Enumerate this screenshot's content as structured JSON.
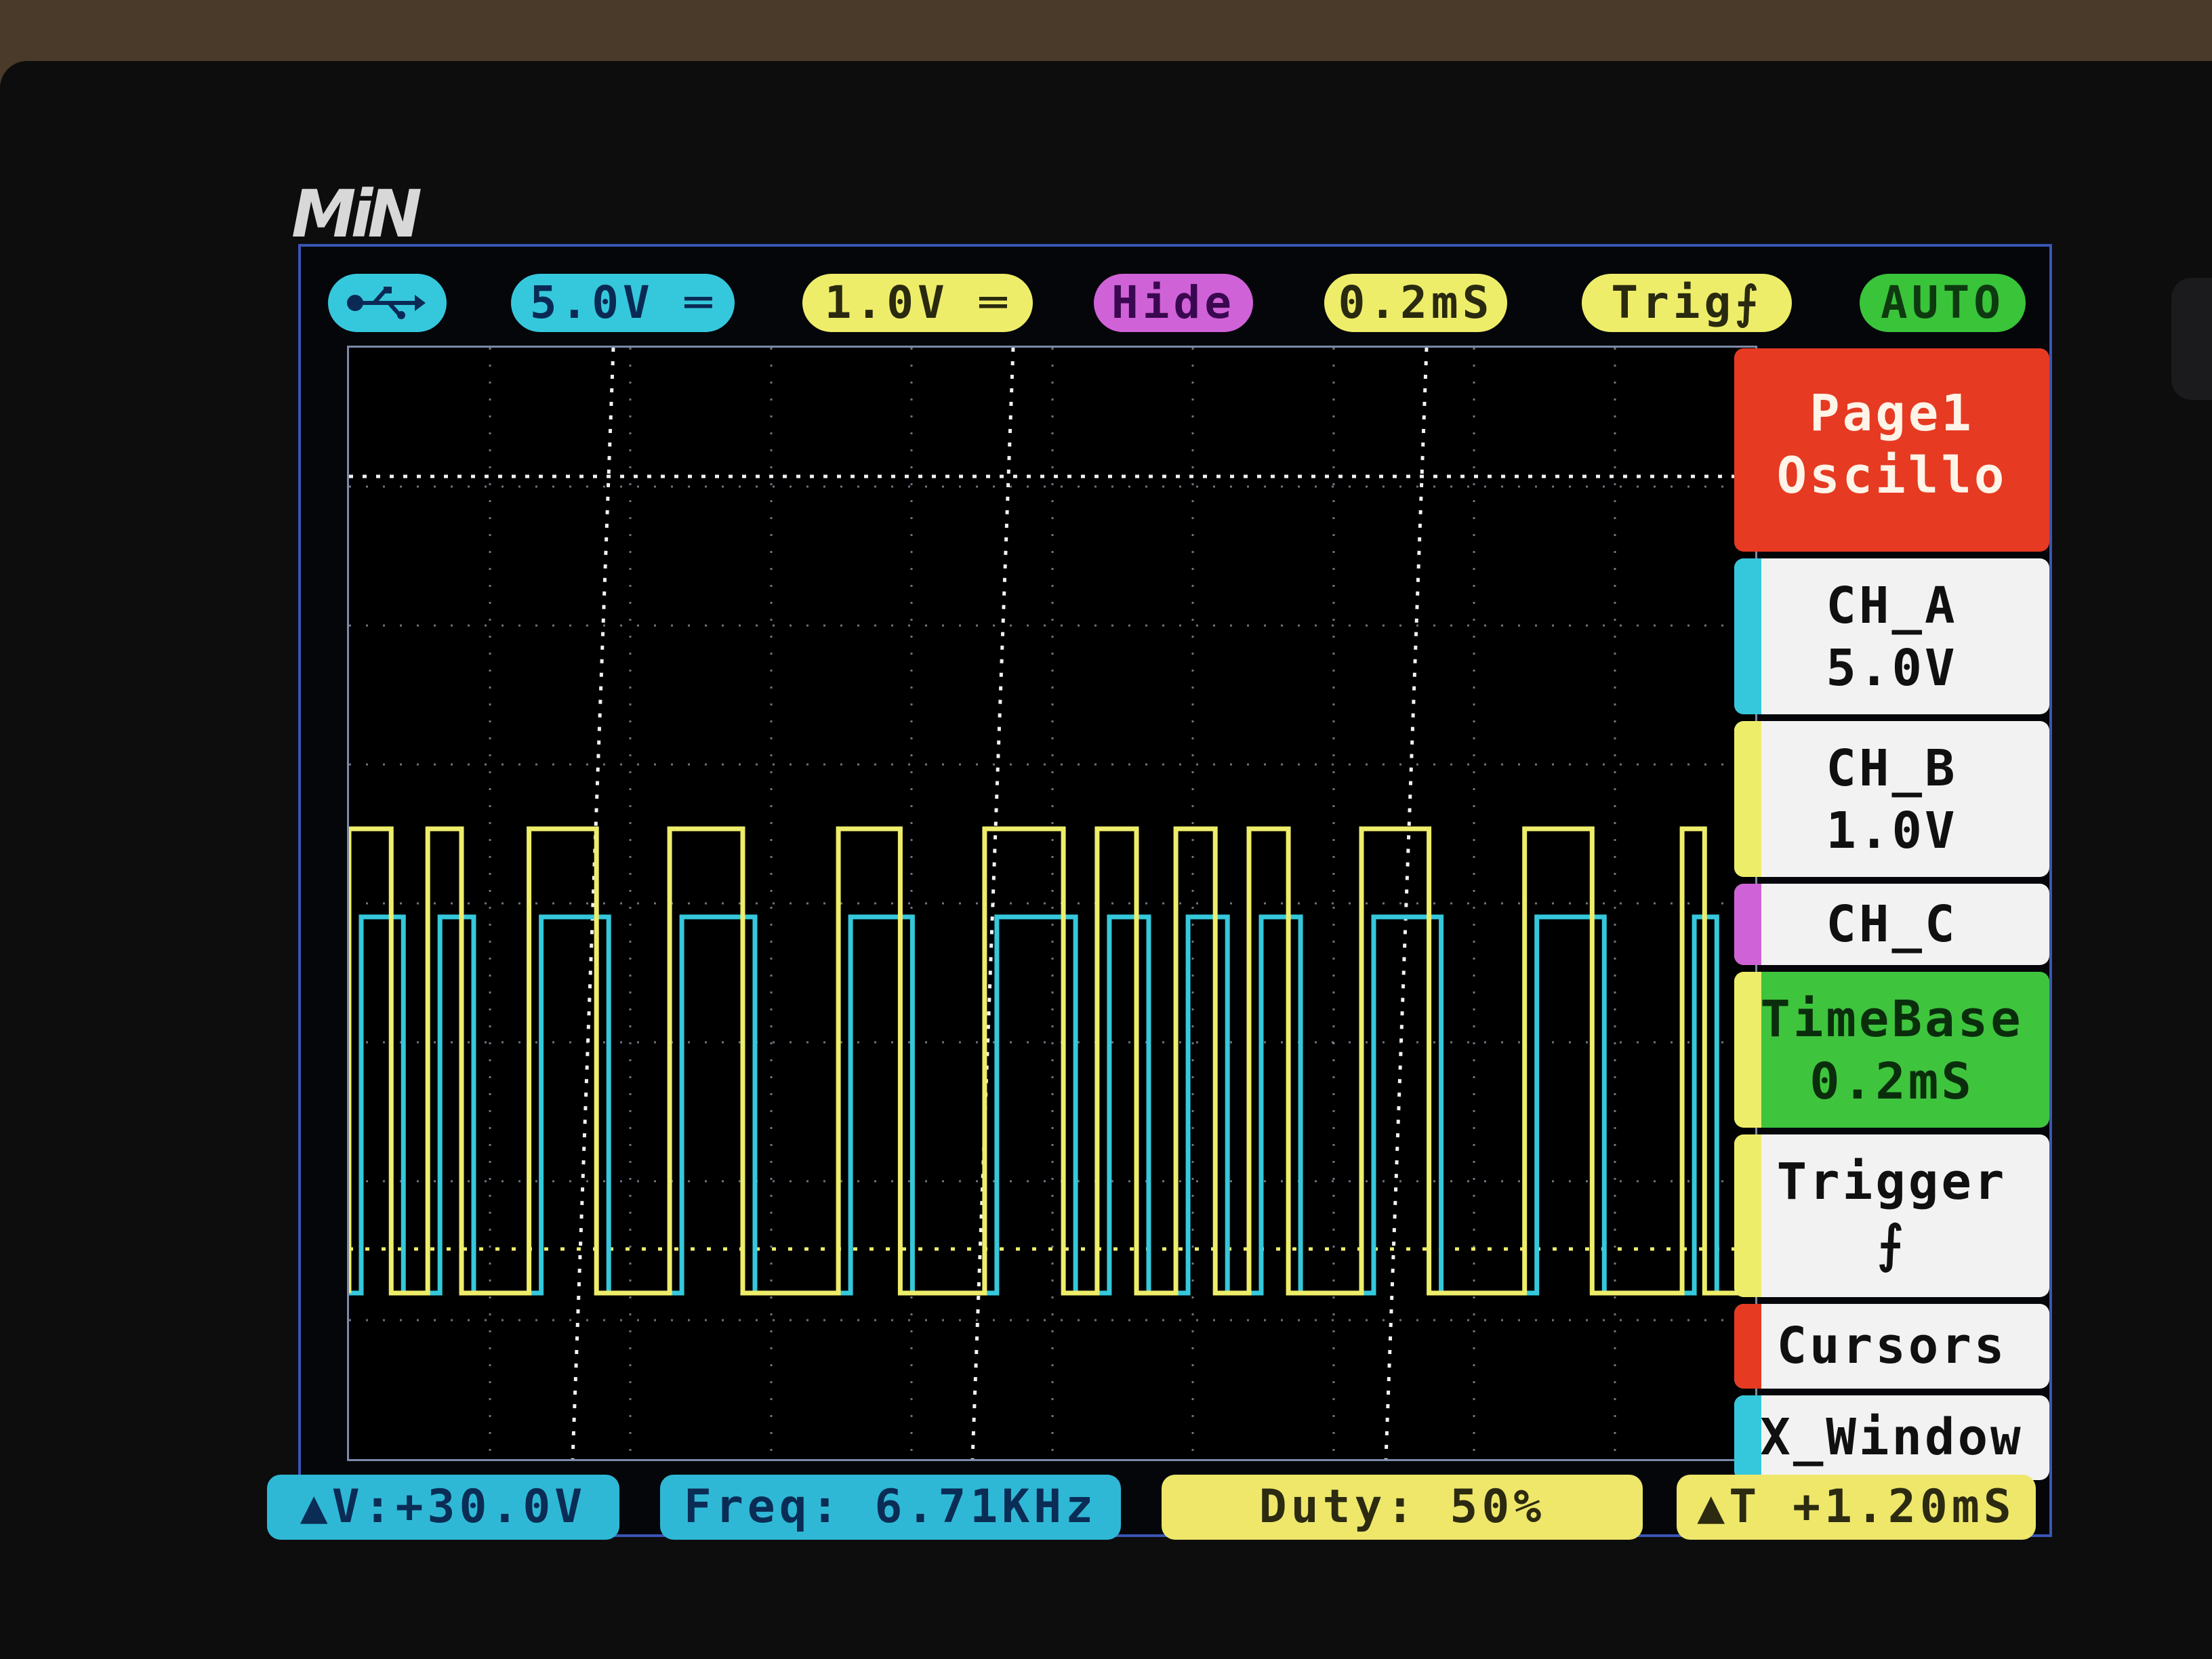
{
  "device": {
    "logo": "MiN"
  },
  "topbar": {
    "usb_icon": "usb-icon",
    "ch_a_scale": "5.0V ═",
    "ch_b_scale": "1.0V ═",
    "ch_c_state": "Hide",
    "timebase": "0.2mS",
    "trigger": "Trig⨍",
    "mode": "AUTO"
  },
  "menu": {
    "page_line1": "Page1",
    "page_line2": "Oscillo",
    "ch_a_line1": "CH_A",
    "ch_a_line2": "5.0V",
    "ch_b_line1": "CH_B",
    "ch_b_line2": "1.0V",
    "ch_c": "CH_C",
    "timebase_line1": "TimeBase",
    "timebase_line2": "0.2mS",
    "trigger_line1": "Trigger",
    "trigger_line2": "⨍",
    "cursors": "Cursors",
    "x_window": "X_Window"
  },
  "readouts": {
    "delta_v": "▲V:+30.0V",
    "freq": "Freq: 6.71KHz",
    "duty": "Duty: 50%",
    "delta_t": "▲T +1.20mS"
  },
  "colors": {
    "ch_a": "#35c8dc",
    "ch_b": "#eeed6a",
    "ch_c": "#d062d8",
    "grid": "#c8d2f0"
  },
  "waveform": {
    "pulses": [
      [
        0.0,
        0.015
      ],
      [
        0.028,
        0.04
      ],
      [
        0.064,
        0.088
      ],
      [
        0.114,
        0.14
      ],
      [
        0.174,
        0.196
      ],
      [
        0.226,
        0.254
      ],
      [
        0.266,
        0.28
      ],
      [
        0.294,
        0.308
      ],
      [
        0.32,
        0.334
      ],
      [
        0.36,
        0.384
      ],
      [
        0.418,
        0.442
      ],
      [
        0.474,
        0.482
      ]
    ]
  }
}
